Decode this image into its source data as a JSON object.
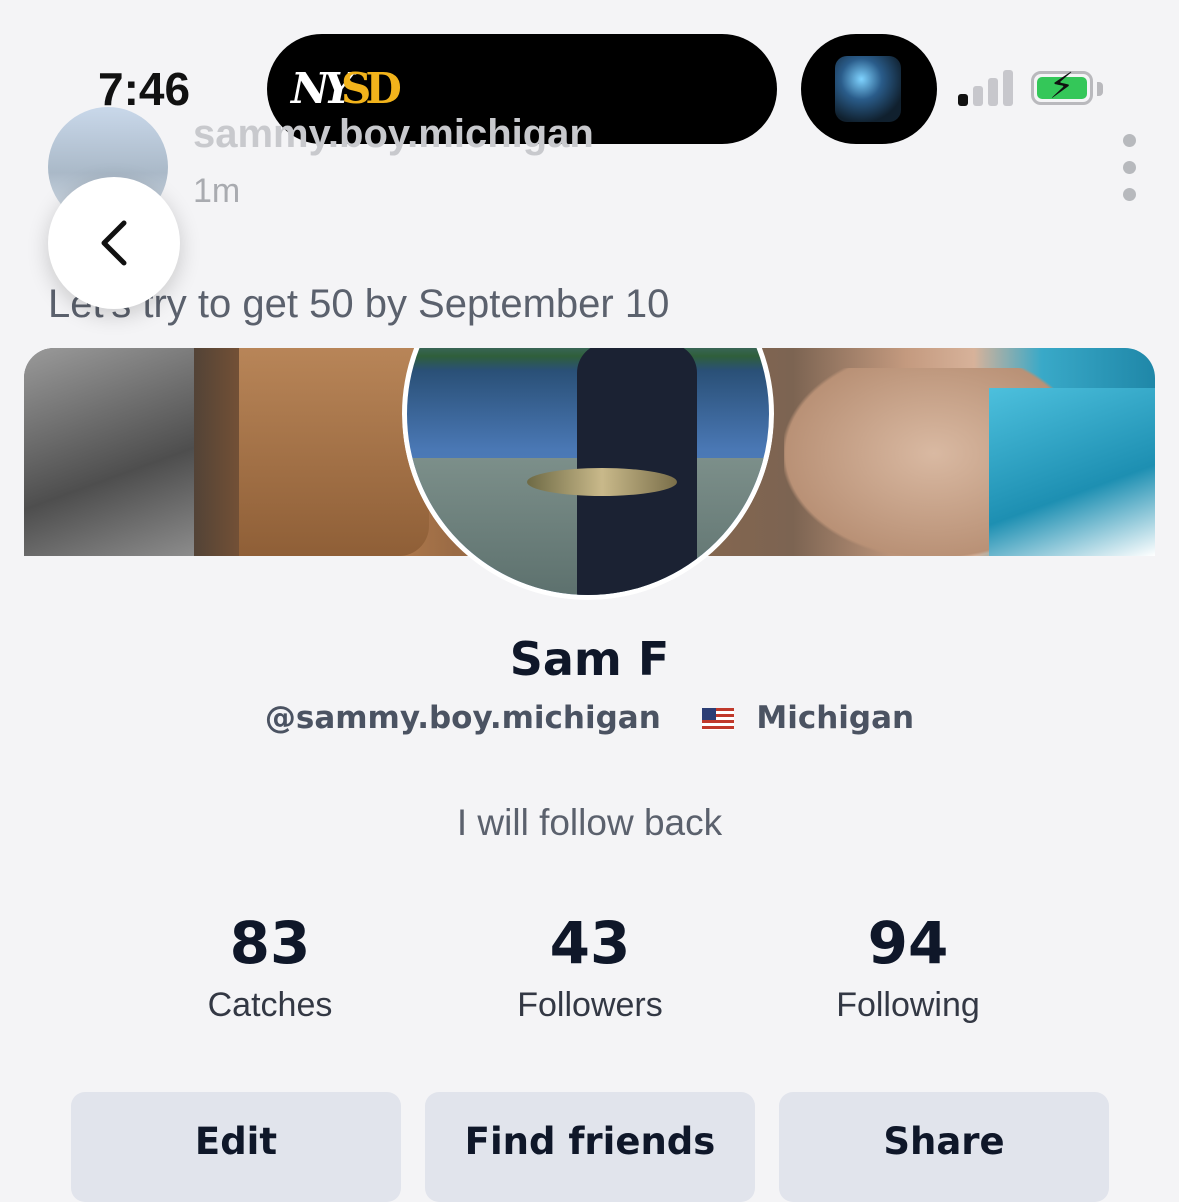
{
  "status_bar": {
    "time": "7:46",
    "island_logos": [
      "NY",
      "SD"
    ],
    "battery_state": "charging",
    "battery_color": "#34c759"
  },
  "post": {
    "username": "sammy.boy.michigan",
    "time_ago": "1m",
    "caption": "Let's try to get 50 by September 10"
  },
  "profile": {
    "name": "Sam F",
    "handle": "@sammy.boy.michigan",
    "location": "Michigan",
    "bio": "I will follow back"
  },
  "stats": [
    {
      "value": "83",
      "label": "Catches"
    },
    {
      "value": "43",
      "label": "Followers"
    },
    {
      "value": "94",
      "label": "Following"
    }
  ],
  "actions": {
    "edit": "Edit",
    "find_friends": "Find friends",
    "share": "Share"
  },
  "icons": {
    "back": "chevron-left-icon",
    "more": "more-vertical-icon",
    "flag": "us-flag-icon"
  },
  "colors": {
    "background": "#f4f4f6",
    "button_bg": "#e1e4ec",
    "text_primary": "#0f1729",
    "text_secondary": "#5b616d"
  }
}
